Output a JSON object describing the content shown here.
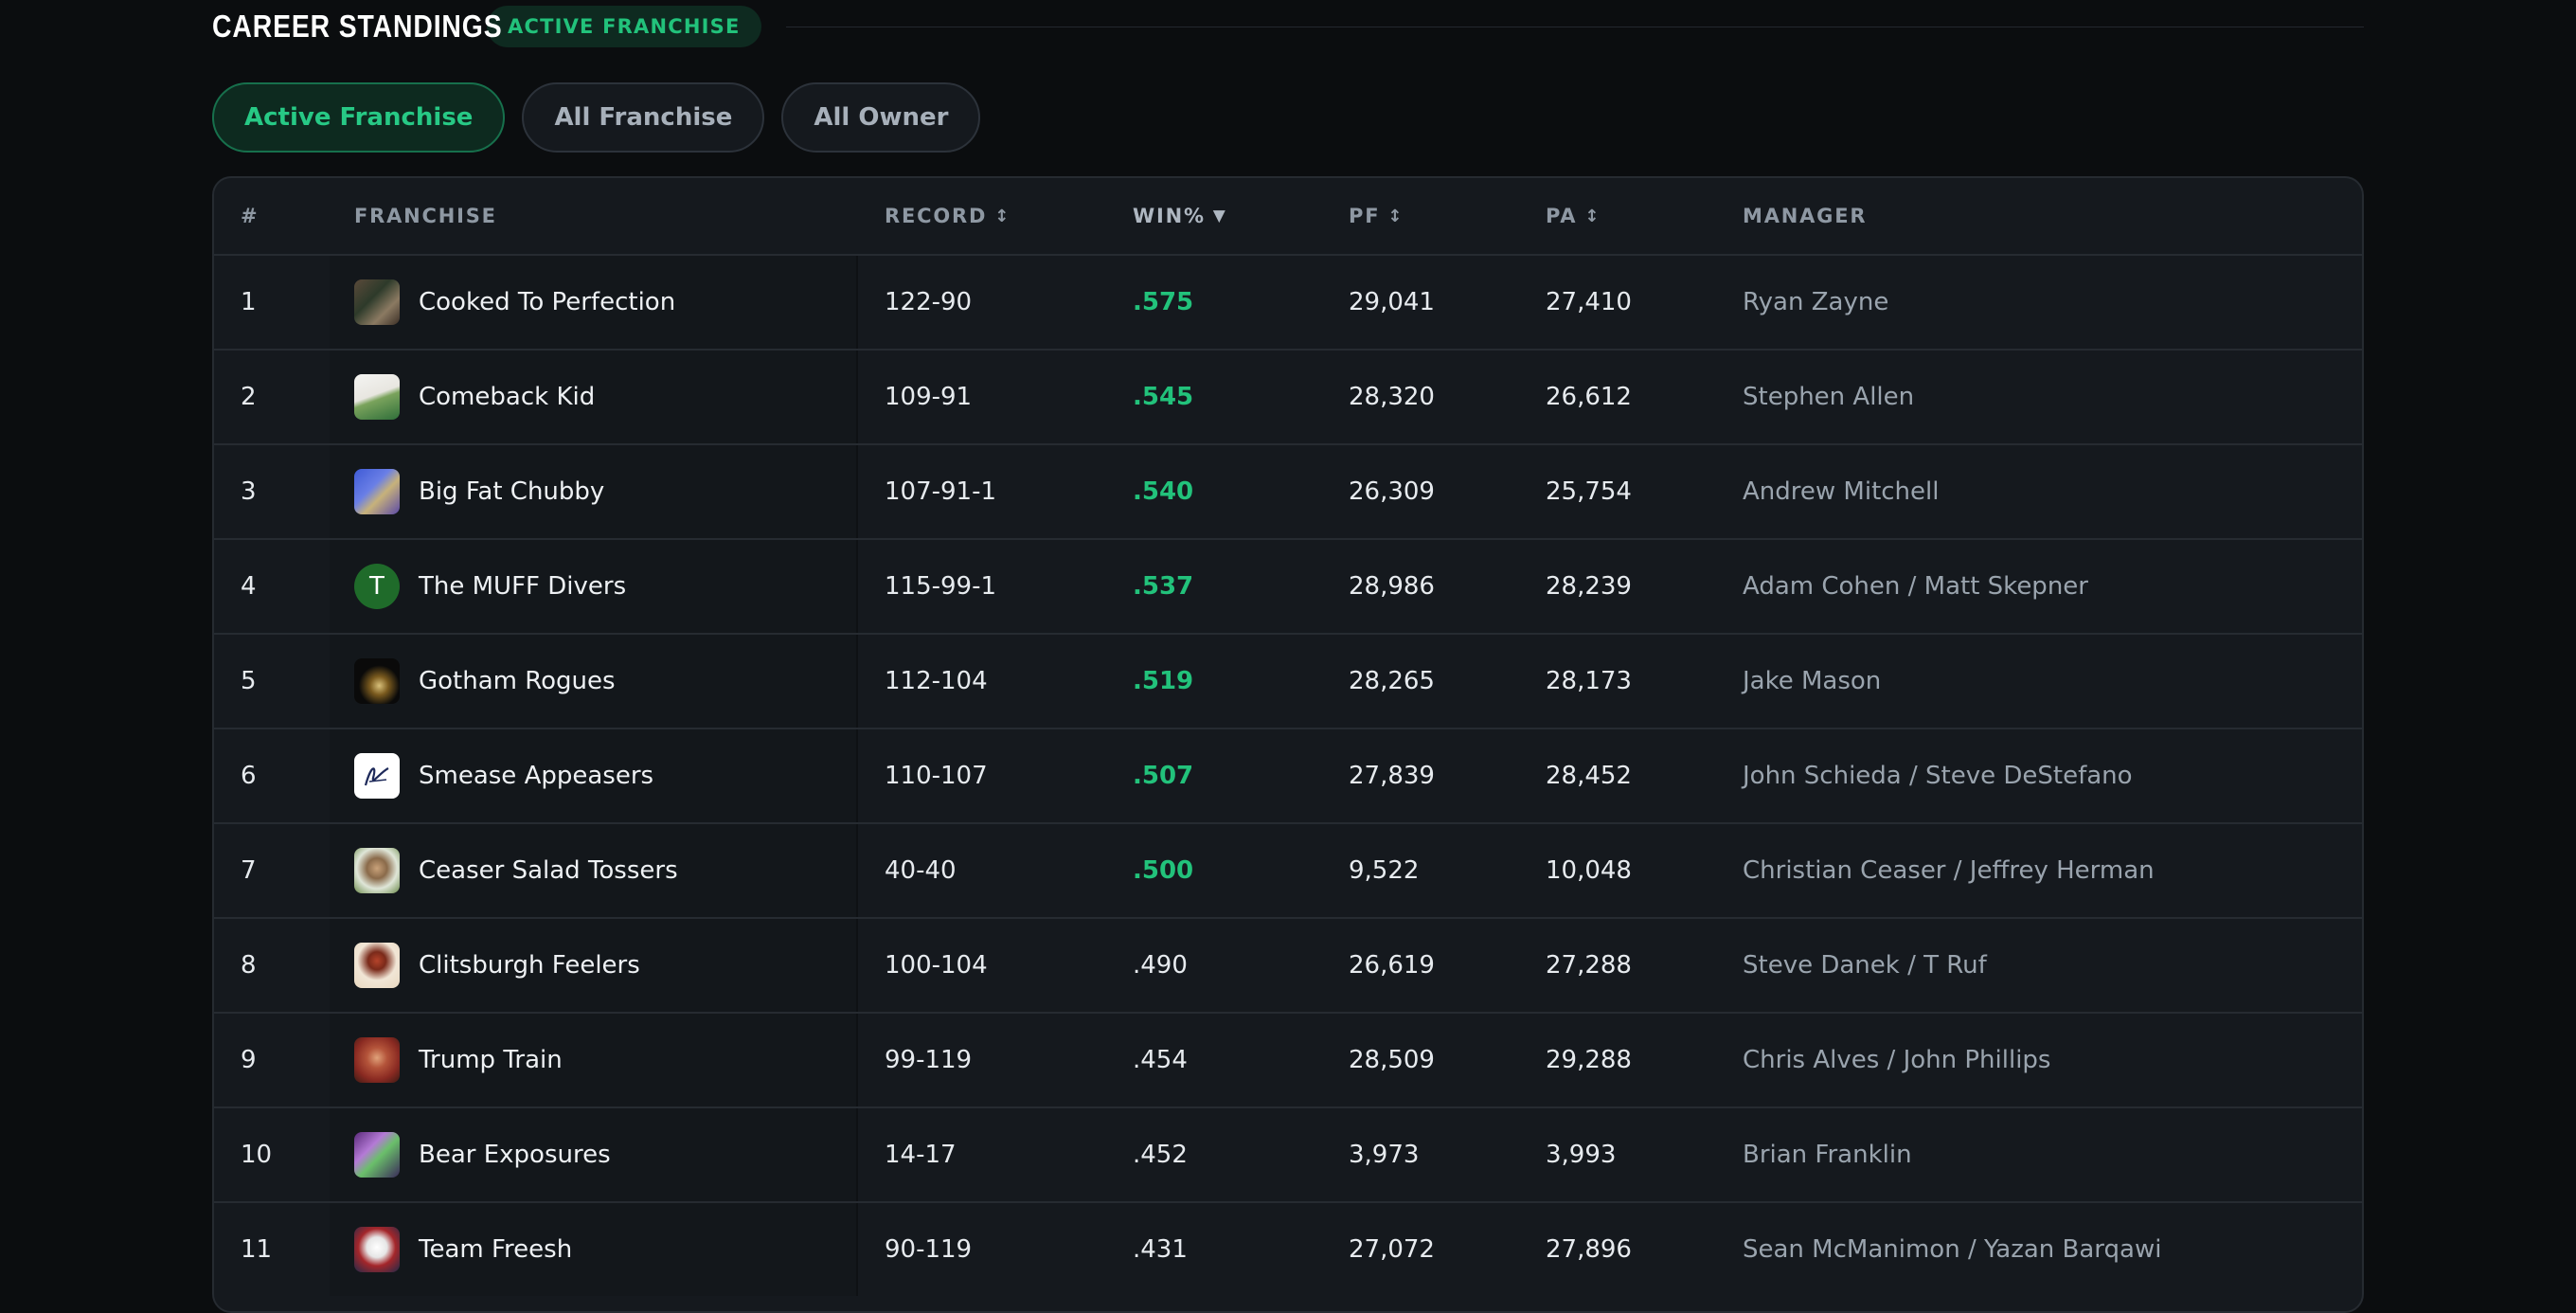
{
  "header": {
    "title": "CAREER STANDINGS",
    "badge": "ACTIVE FRANCHISE"
  },
  "filters": [
    {
      "label": "Active Franchise",
      "active": true
    },
    {
      "label": "All Franchise",
      "active": false
    },
    {
      "label": "All Owner",
      "active": false
    }
  ],
  "table": {
    "columns": {
      "rank": "#",
      "franchise": "FRANCHISE",
      "record": "RECORD",
      "win": "WIN%",
      "pf": "PF",
      "pa": "PA",
      "manager": "MANAGER"
    },
    "sort_icons": {
      "sortable": "↕",
      "sorted_desc": "▼"
    },
    "rows": [
      {
        "rank": "1",
        "team": "Cooked To Perfection",
        "record": "122-90",
        "win": ".575",
        "pf": "29,041",
        "pa": "27,410",
        "manager": "Ryan Zayne",
        "avatar_letter": ""
      },
      {
        "rank": "2",
        "team": "Comeback Kid",
        "record": "109-91",
        "win": ".545",
        "pf": "28,320",
        "pa": "26,612",
        "manager": "Stephen Allen",
        "avatar_letter": ""
      },
      {
        "rank": "3",
        "team": "Big Fat Chubby",
        "record": "107-91-1",
        "win": ".540",
        "pf": "26,309",
        "pa": "25,754",
        "manager": "Andrew Mitchell",
        "avatar_letter": ""
      },
      {
        "rank": "4",
        "team": "The MUFF Divers",
        "record": "115-99-1",
        "win": ".537",
        "pf": "28,986",
        "pa": "28,239",
        "manager": "Adam Cohen / Matt Skepner",
        "avatar_letter": "T"
      },
      {
        "rank": "5",
        "team": "Gotham Rogues",
        "record": "112-104",
        "win": ".519",
        "pf": "28,265",
        "pa": "28,173",
        "manager": "Jake Mason",
        "avatar_letter": ""
      },
      {
        "rank": "6",
        "team": "Smease Appeasers",
        "record": "110-107",
        "win": ".507",
        "pf": "27,839",
        "pa": "28,452",
        "manager": "John Schieda / Steve DeStefano",
        "avatar_letter": ""
      },
      {
        "rank": "7",
        "team": "Ceaser Salad Tossers",
        "record": "40-40",
        "win": ".500",
        "pf": "9,522",
        "pa": "10,048",
        "manager": "Christian Ceaser / Jeffrey Herman",
        "avatar_letter": ""
      },
      {
        "rank": "8",
        "team": "Clitsburgh Feelers",
        "record": "100-104",
        "win": ".490",
        "pf": "26,619",
        "pa": "27,288",
        "manager": "Steve Danek / T Ruf",
        "avatar_letter": ""
      },
      {
        "rank": "9",
        "team": "Trump Train",
        "record": "99-119",
        "win": ".454",
        "pf": "28,509",
        "pa": "29,288",
        "manager": "Chris Alves / John Phillips",
        "avatar_letter": ""
      },
      {
        "rank": "10",
        "team": "Bear Exposures",
        "record": "14-17",
        "win": ".452",
        "pf": "3,973",
        "pa": "3,993",
        "manager": "Brian Franklin",
        "avatar_letter": ""
      },
      {
        "rank": "11",
        "team": "Team Freesh",
        "record": "90-119",
        "win": ".431",
        "pf": "27,072",
        "pa": "27,896",
        "manager": "Sean McManimon / Yazan Barqawi",
        "avatar_letter": ""
      }
    ]
  },
  "colors": {
    "accent": "#22c27b",
    "background": "#0b0d0f",
    "card": "#15191e"
  }
}
